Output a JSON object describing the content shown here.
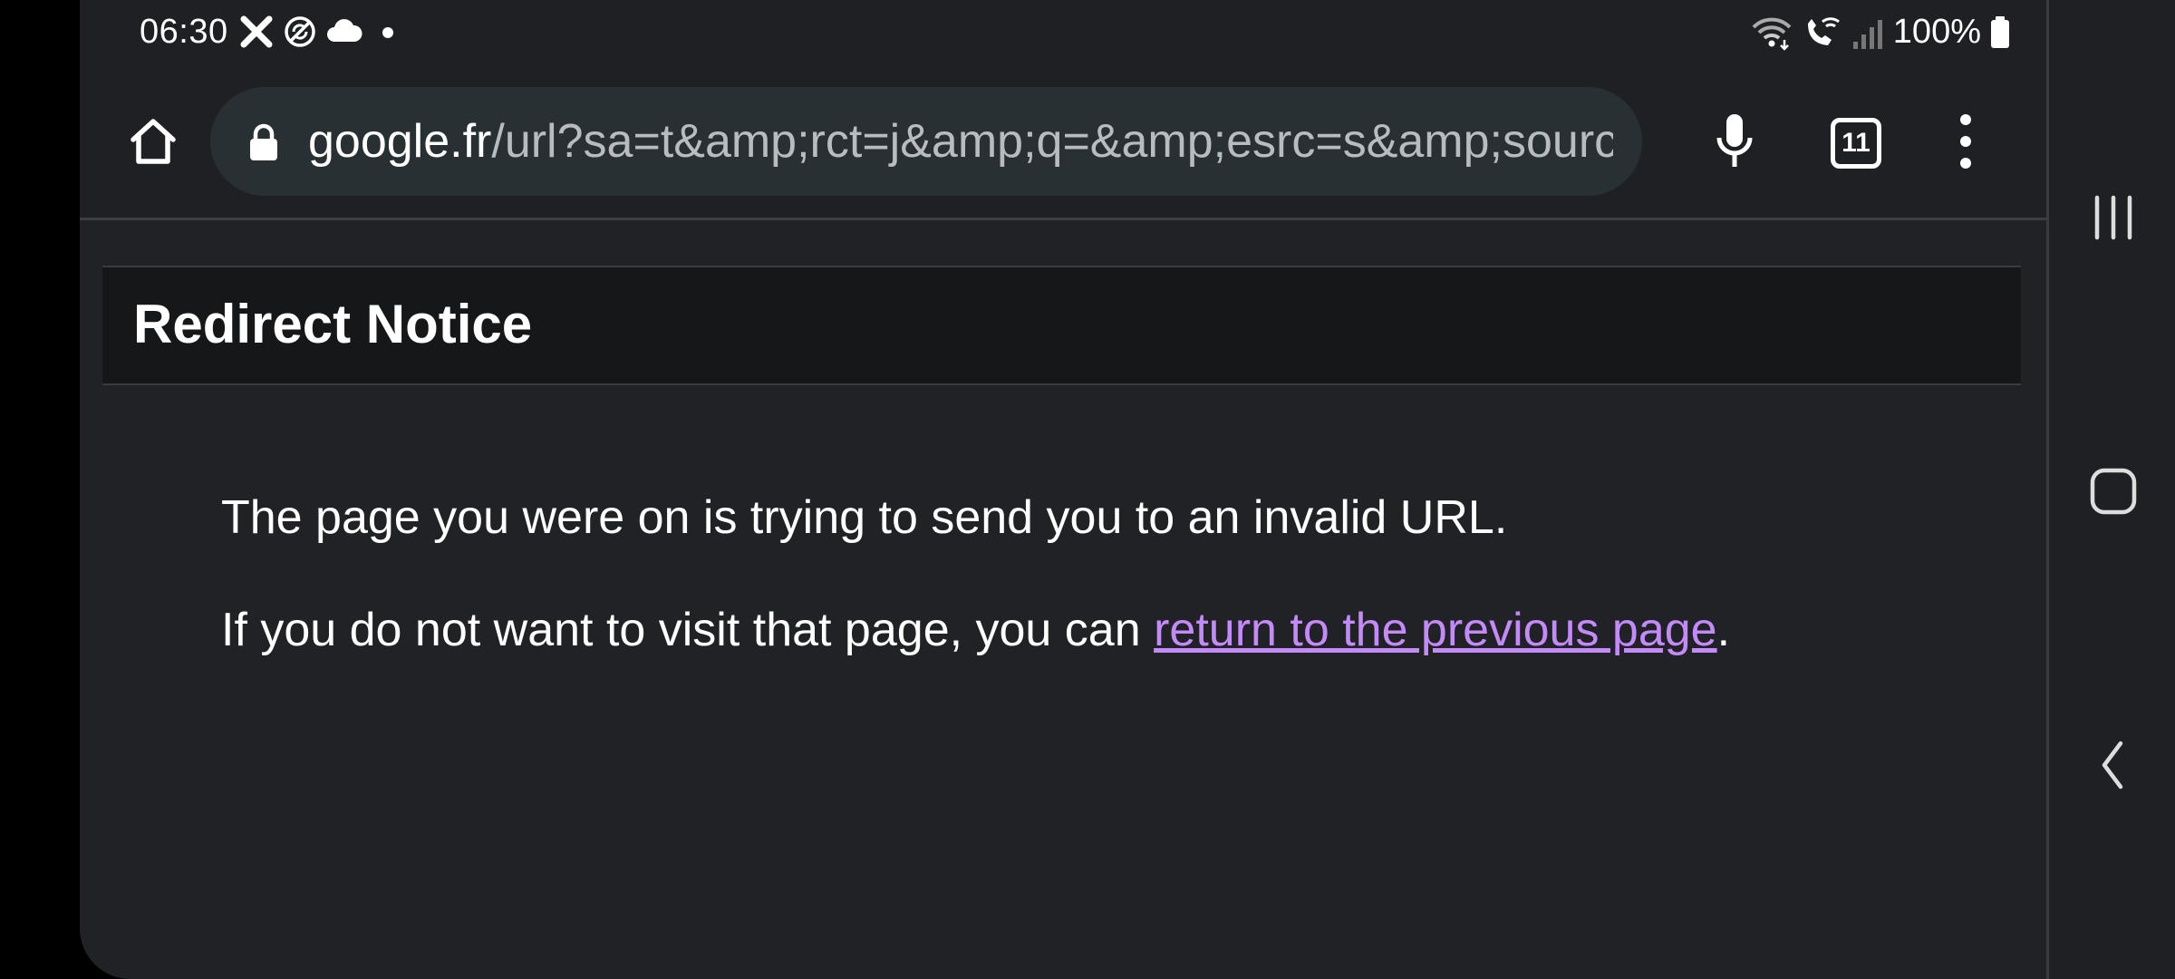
{
  "status_bar": {
    "time": "06:30",
    "battery": "100%",
    "left_icons": [
      "x-icon",
      "no-sync-icon",
      "cloud-icon",
      "dot-icon"
    ],
    "right_icons": [
      "wifi-icon",
      "wifi-calling-icon",
      "signal-icon",
      "battery-icon"
    ]
  },
  "toolbar": {
    "url_domain": "google.fr",
    "url_path": "/url?sa=t&amp;rct=j&amp;q=&amp;esrc=s&amp;sourc",
    "tab_count": "11"
  },
  "page": {
    "title": "Redirect Notice",
    "line1": "The page you were on is trying to send you to an invalid URL.",
    "line2_prefix": "If you do not want to visit that page, you can ",
    "line2_link": "return to the previous page",
    "line2_suffix": "."
  },
  "colors": {
    "background": "#212226",
    "header_band": "#161718",
    "link": "#c58af9",
    "url_bar": "#283034"
  },
  "nav_bar": {
    "icons": [
      "recent-apps-icon",
      "home-nav-icon",
      "back-icon"
    ]
  }
}
